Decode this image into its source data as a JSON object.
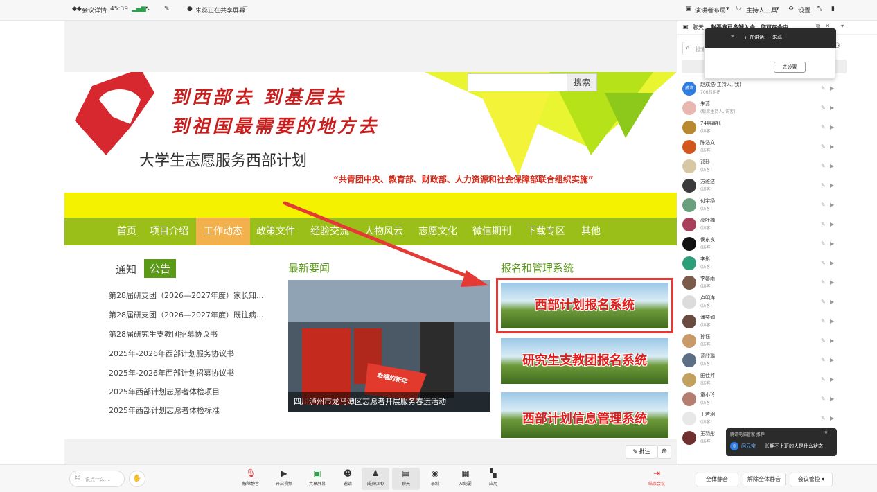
{
  "topbar": {
    "meeting_details": "会议详情",
    "timer": "45:39",
    "sharing_status": "朱蕊正在共享屏幕",
    "layout": "演讲者布局",
    "host_tools": "主持人工具",
    "settings": "设置"
  },
  "website": {
    "slogan_1": "到西部去 到基层去",
    "slogan_2": "到祖国最需要的地方去",
    "site_title": "大学生志愿服务西部计划",
    "subtitle": "“共青团中央、教育部、财政部、人力资源和社会保障部联合组织实施”",
    "search_button": "搜索",
    "nav": [
      "首页",
      "项目介绍",
      "工作动态",
      "政策文件",
      "经验交流",
      "人物风云",
      "志愿文化",
      "微信期刊",
      "下载专区",
      "其他"
    ],
    "tabs": {
      "notice": "通知",
      "announce": "公告"
    },
    "notices": [
      "第28届研支团（2026—2027年度）家长知...",
      "第28届研支团（2026—2027年度）既往病...",
      "第28届研究生支教团招募协议书",
      "2025年-2026年西部计划服务协议书",
      "2025年-2026年西部计划招募协议书",
      "2025年西部计划志愿者体检项目",
      "2025年西部计划志愿者体检标准"
    ],
    "news_heading": "最新要闻",
    "news_caption": "四川泸州市龙马潭区志愿者开展服务春运活动",
    "poster_text": "幸福的新年",
    "systems_heading": "报名和管理系统",
    "systems": [
      "西部计划报名系统",
      "研究生支教团报名系统",
      "西部计划信息管理系统"
    ]
  },
  "share_tools": {
    "annotate": "批注"
  },
  "sidebar": {
    "chat_tab": "聊天",
    "join_notice": "赵磊鑫已多端入会，您可在会中...",
    "search_placeholder": "搜索",
    "speaking_label": "正在讲话:",
    "speaker": "朱蕊",
    "goto_settings": "去设置",
    "avatar_initial": "成浩",
    "members": [
      {
        "name": "赵成浩(主持人, 我)",
        "role": "706的组织",
        "color": "#2f7de1"
      },
      {
        "name": "朱蕊",
        "role": "(联席主持人, 访客)",
        "color": "#e8b7b0"
      },
      {
        "name": "74悬鑫钰",
        "role": "(访客)",
        "color": "#b9892f"
      },
      {
        "name": "陈浩文",
        "role": "(访客)",
        "color": "#d0561b"
      },
      {
        "name": "邓毅",
        "role": "(访客)",
        "color": "#d7c7a4"
      },
      {
        "name": "方雅洁",
        "role": "(访客)",
        "color": "#3b3b3b"
      },
      {
        "name": "付宇扬",
        "role": "(访客)",
        "color": "#6aa07d"
      },
      {
        "name": "高叶楠",
        "role": "(访客)",
        "color": "#a9405b"
      },
      {
        "name": "侯东良",
        "role": "(访客)",
        "color": "#111111"
      },
      {
        "name": "李彤",
        "role": "(访客)",
        "color": "#2e9e7a"
      },
      {
        "name": "李馨雨",
        "role": "(访客)",
        "color": "#7a5a4a"
      },
      {
        "name": "卢明洋",
        "role": "(访客)",
        "color": "#dcdcdc"
      },
      {
        "name": "潘奕如",
        "role": "(访客)",
        "color": "#6b4a3f"
      },
      {
        "name": "孙钰",
        "role": "(访客)",
        "color": "#c89a6a"
      },
      {
        "name": "汤欣璐",
        "role": "(访客)",
        "color": "#5c6f84"
      },
      {
        "name": "田佳笄",
        "role": "(访客)",
        "color": "#c2a15e"
      },
      {
        "name": "童小玲",
        "role": "(访客)",
        "color": "#b57e6e"
      },
      {
        "name": "王若玥",
        "role": "(访客)",
        "color": "#e8e8e8"
      },
      {
        "name": "王羽彤",
        "role": "(访客)",
        "color": "#703030"
      }
    ],
    "popup_title": "腾讯电脑管家·推荐",
    "popup_source": "问元宝",
    "popup_text": "长期不上班的人是什么状态",
    "mute_all": "全体静音",
    "unmute_all": "解除全体静音",
    "control": "会议管控"
  },
  "bottombar": {
    "chat_input_placeholder": "说点什么...",
    "unmute": "解除静音",
    "video": "开启视频",
    "share": "共享屏幕",
    "invite": "邀请",
    "members": "成员(24)",
    "chat": "聊天",
    "record": "录制",
    "ai": "AI纪要",
    "apps": "应用",
    "leave": "结束会议"
  },
  "colors": {
    "nav": "#9bbf19",
    "nav_active": "#f3b14e",
    "slogan": "#c81e1e",
    "highlight": "#e53935",
    "yellow": "#f5f200"
  }
}
